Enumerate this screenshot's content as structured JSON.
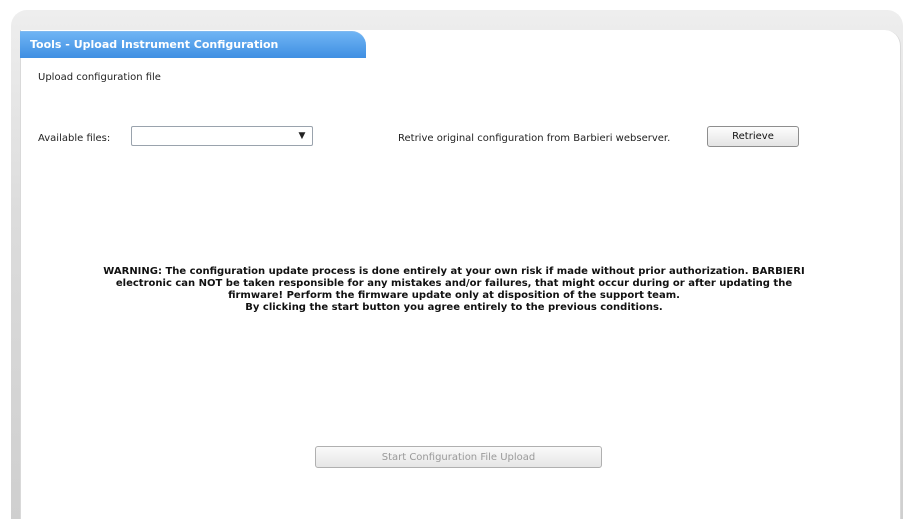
{
  "tab": {
    "title": "Tools - Upload Instrument Configuration"
  },
  "section": {
    "subtitle": "Upload configuration file"
  },
  "files": {
    "label": "Available files:",
    "selected_value": "",
    "dropdown_icon": "chevron-down-icon"
  },
  "retrieve": {
    "label": "Retrive original configuration from Barbieri webserver.",
    "button_label": "Retrieve"
  },
  "warning": {
    "line1": "WARNING: The configuration update process is done entirely at your own risk if made without prior authorization. BARBIERI",
    "line2": "electronic can NOT be taken responsible for any mistakes and/or failures, that might occur during or after updating the",
    "line3": "firmware! Perform the firmware update only at disposition of the support team.",
    "line4": "By clicking the start button you agree entirely to the previous conditions."
  },
  "start": {
    "button_label": "Start Configuration File Upload",
    "enabled": false
  },
  "colors": {
    "tab_blue": "#3f8fe2",
    "frame_gray": "#d4d4d4"
  }
}
